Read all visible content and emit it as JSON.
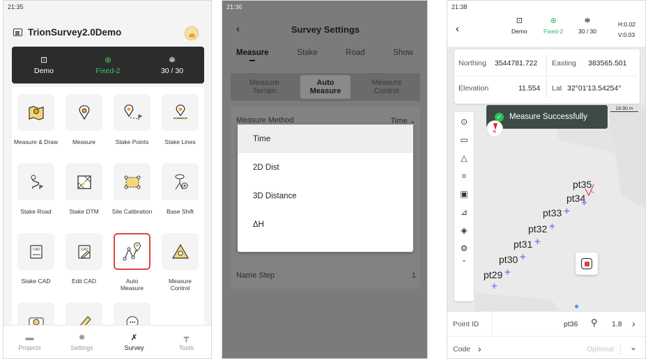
{
  "panel1": {
    "time": "21:35",
    "project_title": "TrionSurvey2.0Demo",
    "status_bar": [
      {
        "icon": "demo-icon",
        "label": "Demo"
      },
      {
        "icon": "crosshair-icon",
        "label": "Fixed-2",
        "color": "#3fc86a"
      },
      {
        "icon": "satellite-icon",
        "label": "30 / 30"
      }
    ],
    "tiles": [
      {
        "label": "Measure & Draw",
        "icon": "map-pin-icon"
      },
      {
        "label": "Measure",
        "icon": "target-icon"
      },
      {
        "label": "Stake Points",
        "icon": "stake-points-icon"
      },
      {
        "label": "Stake Lines",
        "icon": "stake-lines-icon"
      },
      {
        "label": "Stake Road",
        "icon": "stake-road-icon"
      },
      {
        "label": "Stake DTM",
        "icon": "dtm-icon"
      },
      {
        "label": "Site Calibration",
        "icon": "site-calibration-icon"
      },
      {
        "label": "Base Shift",
        "icon": "base-shift-icon"
      },
      {
        "label": "Stake CAD",
        "icon": "cad-icon"
      },
      {
        "label": "Edit CAD",
        "icon": "edit-cad-icon"
      },
      {
        "label": "Auto Measure",
        "icon": "auto-measure-icon",
        "selected": true
      },
      {
        "label": "Measure Control",
        "icon": "measure-control-icon"
      }
    ],
    "tabs": [
      {
        "label": "Projects",
        "icon": "folder-icon"
      },
      {
        "label": "Settings",
        "icon": "gear-icon"
      },
      {
        "label": "Survey",
        "icon": "survey-icon",
        "active": true
      },
      {
        "label": "Tools",
        "icon": "tools-icon"
      }
    ]
  },
  "panel2": {
    "time": "21:36",
    "title": "Survey Settings",
    "tabs": [
      "Measure",
      "Stake",
      "Road",
      "Show"
    ],
    "active_tab": "Measure",
    "segments": [
      "Measure Terrain",
      "Auto Measure",
      "Measure Control"
    ],
    "active_segment": "Auto Measure",
    "method_label": "Measure Method",
    "method_value": "Time",
    "name_step_label": "Name Step",
    "name_step_value": "1",
    "dropdown_options": [
      "Time",
      "2D Dist",
      "3D Distance",
      "ΔH"
    ],
    "selected_option": "Time"
  },
  "panel3": {
    "time": "21:38",
    "header": {
      "mode": "Demo",
      "fix": "Fixed-2",
      "sats": "30 / 30",
      "h_precision": "H:0.02",
      "v_precision": "V:0.03"
    },
    "coords": {
      "northing_label": "Northing",
      "northing": "3544781.722",
      "easting_label": "Easting",
      "easting": "383565.501",
      "elevation_label": "Elevation",
      "elevation": "11.554",
      "lat_label": "Lat",
      "lat": "32°01'13.54254°"
    },
    "toast": "Measure Successfully",
    "scale": "18.90 m",
    "points": [
      "pt35",
      "pt34",
      "pt33",
      "pt32",
      "pt31",
      "pt30",
      "pt29"
    ],
    "point_id_label": "Point ID",
    "point_id": "pt36",
    "antenna_height": "1.8",
    "code_label": "Code",
    "code_placeholder": "Optional"
  }
}
